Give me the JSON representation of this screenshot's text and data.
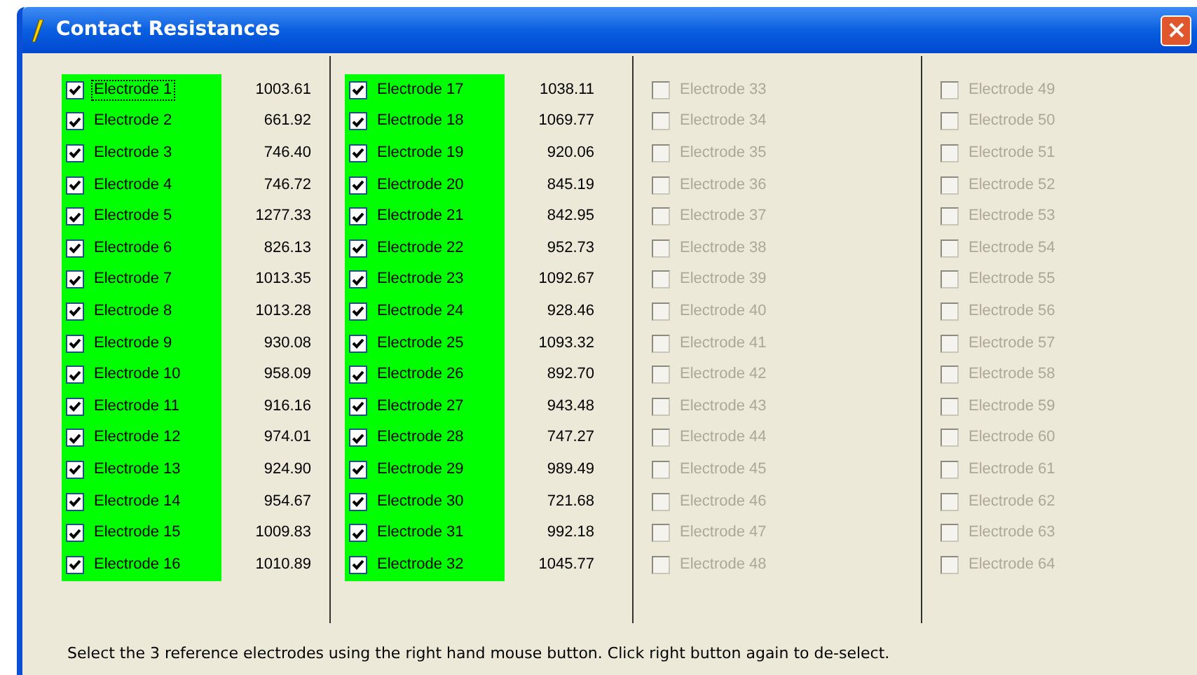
{
  "window": {
    "title": "Contact Resistances"
  },
  "columns": [
    {
      "items": [
        {
          "label": "Electrode 1",
          "value": "1003.61",
          "checked": true,
          "disabled": false,
          "focused": true
        },
        {
          "label": "Electrode 2",
          "value": "661.92",
          "checked": true,
          "disabled": false,
          "focused": false
        },
        {
          "label": "Electrode 3",
          "value": "746.40",
          "checked": true,
          "disabled": false,
          "focused": false
        },
        {
          "label": "Electrode 4",
          "value": "746.72",
          "checked": true,
          "disabled": false,
          "focused": false
        },
        {
          "label": "Electrode 5",
          "value": "1277.33",
          "checked": true,
          "disabled": false,
          "focused": false
        },
        {
          "label": "Electrode 6",
          "value": "826.13",
          "checked": true,
          "disabled": false,
          "focused": false
        },
        {
          "label": "Electrode 7",
          "value": "1013.35",
          "checked": true,
          "disabled": false,
          "focused": false
        },
        {
          "label": "Electrode 8",
          "value": "1013.28",
          "checked": true,
          "disabled": false,
          "focused": false
        },
        {
          "label": "Electrode 9",
          "value": "930.08",
          "checked": true,
          "disabled": false,
          "focused": false
        },
        {
          "label": "Electrode 10",
          "value": "958.09",
          "checked": true,
          "disabled": false,
          "focused": false
        },
        {
          "label": "Electrode 11",
          "value": "916.16",
          "checked": true,
          "disabled": false,
          "focused": false
        },
        {
          "label": "Electrode 12",
          "value": "974.01",
          "checked": true,
          "disabled": false,
          "focused": false
        },
        {
          "label": "Electrode 13",
          "value": "924.90",
          "checked": true,
          "disabled": false,
          "focused": false
        },
        {
          "label": "Electrode 14",
          "value": "954.67",
          "checked": true,
          "disabled": false,
          "focused": false
        },
        {
          "label": "Electrode 15",
          "value": "1009.83",
          "checked": true,
          "disabled": false,
          "focused": false
        },
        {
          "label": "Electrode 16",
          "value": "1010.89",
          "checked": true,
          "disabled": false,
          "focused": false
        }
      ]
    },
    {
      "items": [
        {
          "label": "Electrode 17",
          "value": "1038.11",
          "checked": true,
          "disabled": false,
          "focused": false
        },
        {
          "label": "Electrode 18",
          "value": "1069.77",
          "checked": true,
          "disabled": false,
          "focused": false
        },
        {
          "label": "Electrode 19",
          "value": "920.06",
          "checked": true,
          "disabled": false,
          "focused": false
        },
        {
          "label": "Electrode 20",
          "value": "845.19",
          "checked": true,
          "disabled": false,
          "focused": false
        },
        {
          "label": "Electrode 21",
          "value": "842.95",
          "checked": true,
          "disabled": false,
          "focused": false
        },
        {
          "label": "Electrode 22",
          "value": "952.73",
          "checked": true,
          "disabled": false,
          "focused": false
        },
        {
          "label": "Electrode 23",
          "value": "1092.67",
          "checked": true,
          "disabled": false,
          "focused": false
        },
        {
          "label": "Electrode 24",
          "value": "928.46",
          "checked": true,
          "disabled": false,
          "focused": false
        },
        {
          "label": "Electrode 25",
          "value": "1093.32",
          "checked": true,
          "disabled": false,
          "focused": false
        },
        {
          "label": "Electrode 26",
          "value": "892.70",
          "checked": true,
          "disabled": false,
          "focused": false
        },
        {
          "label": "Electrode 27",
          "value": "943.48",
          "checked": true,
          "disabled": false,
          "focused": false
        },
        {
          "label": "Electrode 28",
          "value": "747.27",
          "checked": true,
          "disabled": false,
          "focused": false
        },
        {
          "label": "Electrode 29",
          "value": "989.49",
          "checked": true,
          "disabled": false,
          "focused": false
        },
        {
          "label": "Electrode 30",
          "value": "721.68",
          "checked": true,
          "disabled": false,
          "focused": false
        },
        {
          "label": "Electrode 31",
          "value": "992.18",
          "checked": true,
          "disabled": false,
          "focused": false
        },
        {
          "label": "Electrode 32",
          "value": "1045.77",
          "checked": true,
          "disabled": false,
          "focused": false
        }
      ]
    },
    {
      "items": [
        {
          "label": "Electrode 33",
          "checked": false,
          "disabled": true,
          "focused": false
        },
        {
          "label": "Electrode 34",
          "checked": false,
          "disabled": true,
          "focused": false
        },
        {
          "label": "Electrode 35",
          "checked": false,
          "disabled": true,
          "focused": false
        },
        {
          "label": "Electrode 36",
          "checked": false,
          "disabled": true,
          "focused": false
        },
        {
          "label": "Electrode 37",
          "checked": false,
          "disabled": true,
          "focused": false
        },
        {
          "label": "Electrode 38",
          "checked": false,
          "disabled": true,
          "focused": false
        },
        {
          "label": "Electrode 39",
          "checked": false,
          "disabled": true,
          "focused": false
        },
        {
          "label": "Electrode 40",
          "checked": false,
          "disabled": true,
          "focused": false
        },
        {
          "label": "Electrode 41",
          "checked": false,
          "disabled": true,
          "focused": false
        },
        {
          "label": "Electrode 42",
          "checked": false,
          "disabled": true,
          "focused": false
        },
        {
          "label": "Electrode 43",
          "checked": false,
          "disabled": true,
          "focused": false
        },
        {
          "label": "Electrode 44",
          "checked": false,
          "disabled": true,
          "focused": false
        },
        {
          "label": "Electrode 45",
          "checked": false,
          "disabled": true,
          "focused": false
        },
        {
          "label": "Electrode 46",
          "checked": false,
          "disabled": true,
          "focused": false
        },
        {
          "label": "Electrode 47",
          "checked": false,
          "disabled": true,
          "focused": false
        },
        {
          "label": "Electrode 48",
          "checked": false,
          "disabled": true,
          "focused": false
        }
      ]
    },
    {
      "items": [
        {
          "label": "Electrode 49",
          "checked": false,
          "disabled": true,
          "focused": false
        },
        {
          "label": "Electrode 50",
          "checked": false,
          "disabled": true,
          "focused": false
        },
        {
          "label": "Electrode 51",
          "checked": false,
          "disabled": true,
          "focused": false
        },
        {
          "label": "Electrode 52",
          "checked": false,
          "disabled": true,
          "focused": false
        },
        {
          "label": "Electrode 53",
          "checked": false,
          "disabled": true,
          "focused": false
        },
        {
          "label": "Electrode 54",
          "checked": false,
          "disabled": true,
          "focused": false
        },
        {
          "label": "Electrode 55",
          "checked": false,
          "disabled": true,
          "focused": false
        },
        {
          "label": "Electrode 56",
          "checked": false,
          "disabled": true,
          "focused": false
        },
        {
          "label": "Electrode 57",
          "checked": false,
          "disabled": true,
          "focused": false
        },
        {
          "label": "Electrode 58",
          "checked": false,
          "disabled": true,
          "focused": false
        },
        {
          "label": "Electrode 59",
          "checked": false,
          "disabled": true,
          "focused": false
        },
        {
          "label": "Electrode 60",
          "checked": false,
          "disabled": true,
          "focused": false
        },
        {
          "label": "Electrode 61",
          "checked": false,
          "disabled": true,
          "focused": false
        },
        {
          "label": "Electrode 62",
          "checked": false,
          "disabled": true,
          "focused": false
        },
        {
          "label": "Electrode 63",
          "checked": false,
          "disabled": true,
          "focused": false
        },
        {
          "label": "Electrode 64",
          "checked": false,
          "disabled": true,
          "focused": false
        }
      ]
    }
  ],
  "status_text": "Select the 3 reference electrodes using the right hand mouse button.  Click right button again to de-select."
}
